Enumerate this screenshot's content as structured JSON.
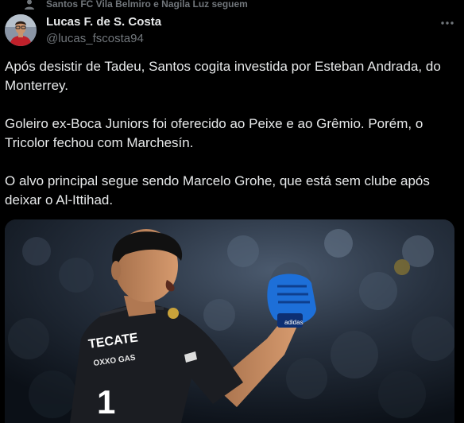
{
  "social_context": {
    "text": "Santos FC Vila Belmiro e Nagila Luz seguem"
  },
  "author": {
    "name": "Lucas F. de S. Costa",
    "handle": "@lucas_fscosta94"
  },
  "tweet": {
    "paragraphs": [
      "Após desistir de Tadeu, Santos cogita investida por Esteban Andrada, do Monterrey.",
      "Goleiro ex-Boca Juniors foi oferecido ao Peixe e ao Grêmio. Porém, o Tricolor fechou com Marchesín.",
      "O alvo principal segue sendo Marcelo Grohe, que está sem clube após deixar o Al-Ittihad."
    ]
  },
  "media": {
    "jersey_sponsor": "TECATE",
    "jersey_sponsor_2": "OXXO GAS",
    "jersey_number": "1",
    "glove_brand": "adidas"
  },
  "icons": {
    "social": "user-icon",
    "more": "more-horizontal-icon"
  },
  "colors": {
    "background": "#000000",
    "text": "#e7e9ea",
    "secondary": "#71767b",
    "glove": "#1d6fd8"
  }
}
